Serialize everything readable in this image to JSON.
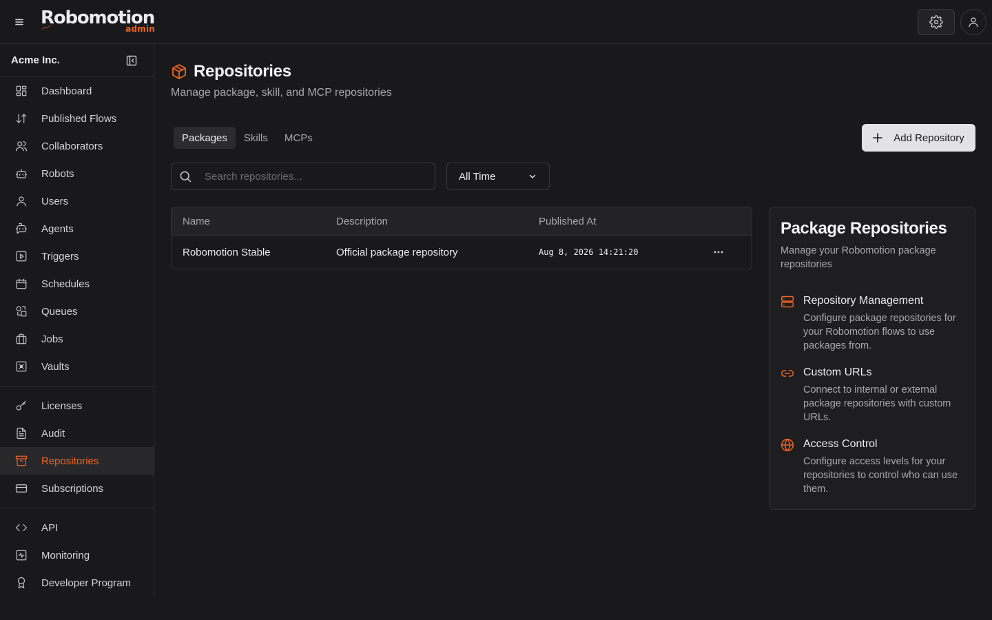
{
  "app": {
    "logo_text": "Robomotion",
    "logo_sub": "admin",
    "brand_color": "#f26522"
  },
  "header": {
    "menu_icon": "hamburger-icon",
    "settings_icon": "gear-icon",
    "profile_icon": "user-icon"
  },
  "sidebar": {
    "org_name": "Acme Inc.",
    "groups": [
      [
        {
          "label": "Dashboard",
          "icon": "dashboard-icon"
        },
        {
          "label": "Published Flows",
          "icon": "arrows-up-down-icon"
        },
        {
          "label": "Collaborators",
          "icon": "users-icon"
        },
        {
          "label": "Robots",
          "icon": "robot-icon"
        },
        {
          "label": "Users",
          "icon": "user-icon"
        },
        {
          "label": "Agents",
          "icon": "bot-message-icon"
        },
        {
          "label": "Triggers",
          "icon": "play-square-icon"
        },
        {
          "label": "Schedules",
          "icon": "calendar-icon"
        },
        {
          "label": "Queues",
          "icon": "shapes-icon"
        },
        {
          "label": "Jobs",
          "icon": "briefcase-icon"
        },
        {
          "label": "Vaults",
          "icon": "vault-icon"
        }
      ],
      [
        {
          "label": "Licenses",
          "icon": "key-icon"
        },
        {
          "label": "Audit",
          "icon": "file-text-icon"
        },
        {
          "label": "Repositories",
          "icon": "archive-icon",
          "active": true
        },
        {
          "label": "Subscriptions",
          "icon": "credit-card-icon"
        }
      ],
      [
        {
          "label": "API",
          "icon": "code-icon"
        },
        {
          "label": "Monitoring",
          "icon": "activity-icon"
        },
        {
          "label": "Developer Program",
          "icon": "award-icon"
        }
      ]
    ]
  },
  "main": {
    "title": "Repositories",
    "subtitle": "Manage package, skill, and MCP repositories",
    "tabs": [
      {
        "label": "Packages",
        "active": true
      },
      {
        "label": "Skills"
      },
      {
        "label": "MCPs"
      }
    ],
    "add_button_label": "Add Repository",
    "search": {
      "placeholder": "Search repositories...",
      "value": ""
    },
    "time_filter": {
      "selected": "All Time"
    },
    "table": {
      "columns": [
        "Name",
        "Description",
        "Published At"
      ],
      "rows": [
        {
          "name": "Robomotion Stable",
          "description": "Official package repository",
          "published_at": "Aug 8, 2026 14:21:20"
        }
      ]
    }
  },
  "info_panel": {
    "title": "Package Repositories",
    "subtitle": "Manage your Robomotion package repositories",
    "features": [
      {
        "icon": "server-icon",
        "title": "Repository Management",
        "description": "Configure package repositories for your Robomotion flows to use packages from."
      },
      {
        "icon": "link-icon",
        "title": "Custom URLs",
        "description": "Connect to internal or external package repositories with custom URLs."
      },
      {
        "icon": "globe-icon",
        "title": "Access Control",
        "description": "Configure access levels for your repositories to control who can use them."
      }
    ]
  }
}
